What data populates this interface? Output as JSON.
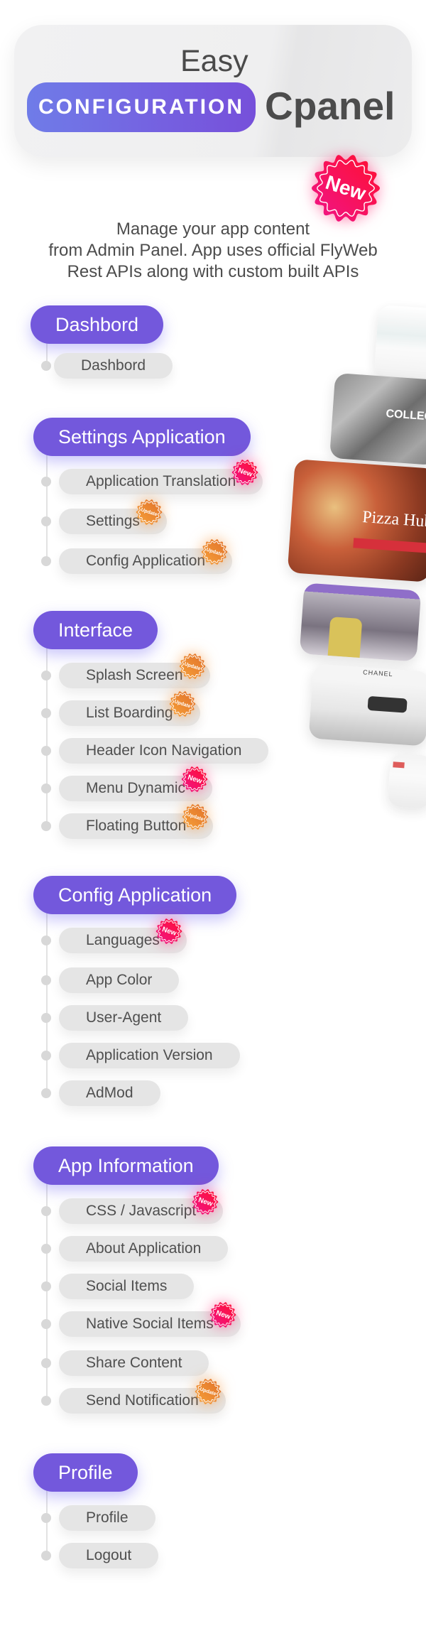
{
  "hero": {
    "easy": "Easy",
    "configuration": "CONFIGURATION",
    "cpanel": "Cpanel"
  },
  "hero_badge": "New",
  "description": [
    "Manage your app content",
    "from Admin Panel. App uses official FlyWeb",
    "Rest APIs along with custom built APIs"
  ],
  "colors": {
    "accent": "#7358dc",
    "new_badge": "#f0146a",
    "update_badge": "#ef8a2c",
    "pill": "#e5e5e5"
  },
  "sections": [
    {
      "title": "Dashbord",
      "items": [
        {
          "label": "Dashbord",
          "badge": null
        }
      ]
    },
    {
      "title": "Settings Application",
      "items": [
        {
          "label": "Application Translation",
          "badge": "New"
        },
        {
          "label": "Settings",
          "badge": "Update"
        },
        {
          "label": "Config Application",
          "badge": "Update"
        }
      ]
    },
    {
      "title": "Interface",
      "items": [
        {
          "label": "Splash Screen",
          "badge": "Update"
        },
        {
          "label": "List Boarding",
          "badge": "Update"
        },
        {
          "label": "Header Icon Navigation",
          "badge": null
        },
        {
          "label": "Menu Dynamic",
          "badge": "New"
        },
        {
          "label": "Floating Button",
          "badge": "Update"
        }
      ]
    },
    {
      "title": "Config Application",
      "items": [
        {
          "label": "Languages",
          "badge": "New"
        },
        {
          "label": "App Color",
          "badge": null
        },
        {
          "label": "User-Agent",
          "badge": null
        },
        {
          "label": "Application Version",
          "badge": null
        },
        {
          "label": "AdMod",
          "badge": null
        }
      ]
    },
    {
      "title": "App Information",
      "items": [
        {
          "label": "CSS / Javascript",
          "badge": "New"
        },
        {
          "label": "About Application",
          "badge": null
        },
        {
          "label": "Social Items",
          "badge": null
        },
        {
          "label": "Native Social Items",
          "badge": "New"
        },
        {
          "label": "Share Content",
          "badge": null
        },
        {
          "label": "Send Notification",
          "badge": "Update"
        }
      ]
    },
    {
      "title": "Profile",
      "items": [
        {
          "label": "Profile",
          "badge": null
        },
        {
          "label": "Logout",
          "badge": null
        }
      ]
    }
  ],
  "screenshots": {
    "collection_label": "COLLECTIO",
    "pizza_label": "Pizza Hub",
    "chanel_label": "CHANEL"
  }
}
